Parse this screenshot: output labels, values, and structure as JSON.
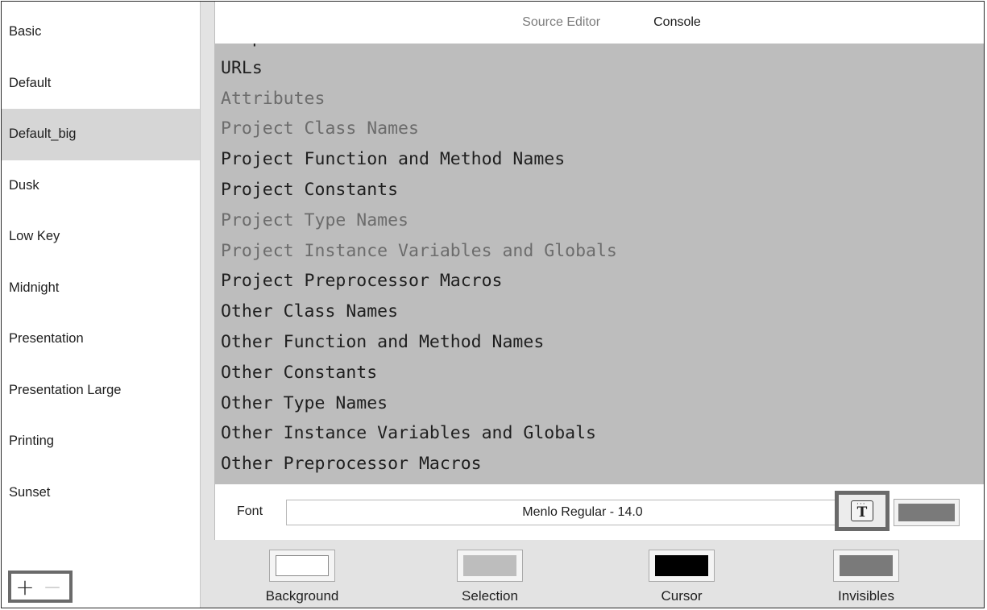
{
  "sidebar": {
    "themes": [
      {
        "label": "Basic"
      },
      {
        "label": "Default"
      },
      {
        "label": "Default_big"
      },
      {
        "label": "Dusk"
      },
      {
        "label": "Low Key"
      },
      {
        "label": "Midnight"
      },
      {
        "label": "Presentation"
      },
      {
        "label": "Presentation Large"
      },
      {
        "label": "Printing"
      },
      {
        "label": "Sunset"
      }
    ],
    "selected": "Default_big",
    "add_label": "+",
    "remove_label": "−"
  },
  "tabs": [
    {
      "label": "Source Editor",
      "active": false
    },
    {
      "label": "Console",
      "active": true
    }
  ],
  "syntax_items": [
    {
      "label": "Preprocessor Statements",
      "tone": "dark"
    },
    {
      "label": "URLs",
      "tone": "dark"
    },
    {
      "label": "Attributes",
      "tone": "light"
    },
    {
      "label": "Project Class Names",
      "tone": "light"
    },
    {
      "label": "Project Function and Method Names",
      "tone": "dark"
    },
    {
      "label": "Project Constants",
      "tone": "dark"
    },
    {
      "label": "Project Type Names",
      "tone": "light"
    },
    {
      "label": "Project Instance Variables and Globals",
      "tone": "light"
    },
    {
      "label": "Project Preprocessor Macros",
      "tone": "dark"
    },
    {
      "label": "Other Class Names",
      "tone": "dark"
    },
    {
      "label": "Other Function and Method Names",
      "tone": "dark"
    },
    {
      "label": "Other Constants",
      "tone": "dark"
    },
    {
      "label": "Other Type Names",
      "tone": "dark"
    },
    {
      "label": "Other Instance Variables and Globals",
      "tone": "dark"
    },
    {
      "label": "Other Preprocessor Macros",
      "tone": "dark"
    }
  ],
  "font": {
    "label": "Font",
    "value": "Menlo Regular - 14.0",
    "color": "#7a7a7a"
  },
  "wells": [
    {
      "label": "Background",
      "color": "#ffffff"
    },
    {
      "label": "Selection",
      "color": "#bdbdbd"
    },
    {
      "label": "Cursor",
      "color": "#000000"
    },
    {
      "label": "Invisibles",
      "color": "#7a7a7a"
    }
  ],
  "colors": {
    "syntax_background": "#bdbdbd",
    "selected_row": "#d6d6d6",
    "highlight_border": "#6a6a6a"
  }
}
